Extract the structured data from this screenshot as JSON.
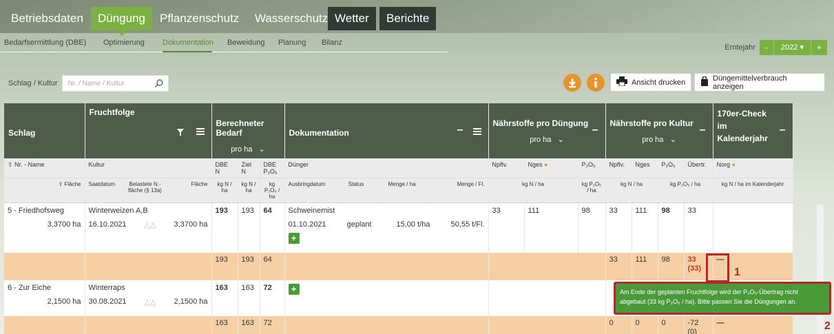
{
  "nav": {
    "tabs": [
      "Betriebsdaten",
      "Düngung",
      "Pflanzenschutz",
      "Wasserschutz",
      "Wetter",
      "Berichte"
    ],
    "subtabs": [
      "Bedarfsermittlung (DBE)",
      "Optimierung",
      "Dokumentation",
      "Beweidung",
      "Planung",
      "Bilanz"
    ]
  },
  "erntejahr": {
    "label": "Erntejahr",
    "minus": "-",
    "year": "2022 ▾",
    "plus": "+"
  },
  "filter": {
    "label": "Schlag / Kultur",
    "placeholder": "Nr. / Name / Kultur"
  },
  "toolbar": {
    "download_icon": "download-icon",
    "info_icon": "info-icon",
    "print_label": "Ansicht drucken",
    "usage_label": "Düngemittelverbrauch anzeigen"
  },
  "headers": {
    "schlag": "Schlag",
    "fruchtfolge": "Fruchtfolge",
    "bedarf": "Berechneter Bedarf",
    "bedarf_sel": "pro ha",
    "doku": "Dokumentation",
    "naehr_dueng": "Nährstoffe pro Düngung",
    "naehr_dueng_sel": "pro ha",
    "naehr_kultur": "Nährstoffe pro Kultur",
    "naehr_kultur_sel": "pro ha",
    "check_l1": "170er-Check",
    "check_l2": "im",
    "check_l3": "Kalenderjahr"
  },
  "sub1": {
    "nr_name": "⇧ Nr. - Name",
    "kultur": "Kultur",
    "dbe_n": "DBE N",
    "ziel_n": "Ziel N",
    "dbe_p": "DBE P₂O₅",
    "duenger": "Dünger",
    "npflv": "Npflv.",
    "nges": "Nges",
    "p2o5": "P₂O₅",
    "npflv2": "Npflv.",
    "nges2": "Nges",
    "p2o5b": "P₂O₅",
    "uebertr": "Übertr.",
    "norg": "Norg"
  },
  "sub2": {
    "flaeche": "⇧ Fläche",
    "saatdatum": "Saatdatum",
    "belastete": "Belastete N.-fläche (§ 13a)",
    "flaeche2": "Fläche",
    "kgn1": "kg N / ha",
    "kgn2": "kg N / ha",
    "kgp": "kg P₂O₅ / ha",
    "ausbringdatum": "Ausbringdatum",
    "status": "Status",
    "menge_ha": "Menge / ha",
    "menge_fl": "Menge / Fl.",
    "kgn_ha": "kg N / ha",
    "kgp_ha": "kg P₂O₅ / ha",
    "kgn_ha2": "kg N / ha",
    "kgp_ha2": "kg P₂O₅ / ha",
    "kgn_kal": "kg N / ha im Kalenderjahr"
  },
  "rows": [
    {
      "name": "5 - Friedhofsweg",
      "area": "3,3700 ha",
      "kultur": "Winterweizen A,B",
      "saat": "16.10.2021",
      "flaeche": "3,3700 ha",
      "dbe_n": "193",
      "ziel_n": "193",
      "dbe_p": "64",
      "duenger": "Schweinemist",
      "datum": "01.10.2021",
      "status": "geplant",
      "menge_ha": "15,00 t/ha",
      "menge_fl": "50,55 t/Fl.",
      "d_npflv": "33",
      "d_nges": "111",
      "d_p": "98",
      "k_npflv": "33",
      "k_nges": "111",
      "k_p": "98",
      "k_ue": "33",
      "sum": {
        "dbe_n": "193",
        "ziel_n": "193",
        "dbe_p": "64",
        "k_npflv": "33",
        "k_nges": "111",
        "k_p": "98",
        "k_ue": "33",
        "k_ue2": "(33)",
        "check": "—"
      }
    },
    {
      "name": "6 - Zur Eiche",
      "area": "2,1500 ha",
      "kultur": "Winterraps",
      "saat": "30.08.2021",
      "flaeche": "2,1500 ha",
      "dbe_n": "163",
      "ziel_n": "163",
      "dbe_p": "72",
      "sum": {
        "dbe_n": "163",
        "ziel_n": "163",
        "dbe_p": "72",
        "k_npflv": "0",
        "k_nges": "0",
        "k_p": "0",
        "k_ue": "-72",
        "k_ue2": "(0)",
        "check": "—"
      }
    }
  ],
  "tooltip": "Am Ende der geplanten Fruchtfolge wird der P₂O₅-Übertrag nicht abgebaut (33 kg P₂O₅ / ha). Bitte passen Sie die Düngungen an.",
  "markers": [
    "1",
    "2"
  ],
  "colors": {
    "brand_green": "#7bb043",
    "header_dark": "#4f5c49",
    "orange": "#e7922a",
    "sum_row": "#f7cfa5",
    "alert_red": "#b3262a"
  }
}
